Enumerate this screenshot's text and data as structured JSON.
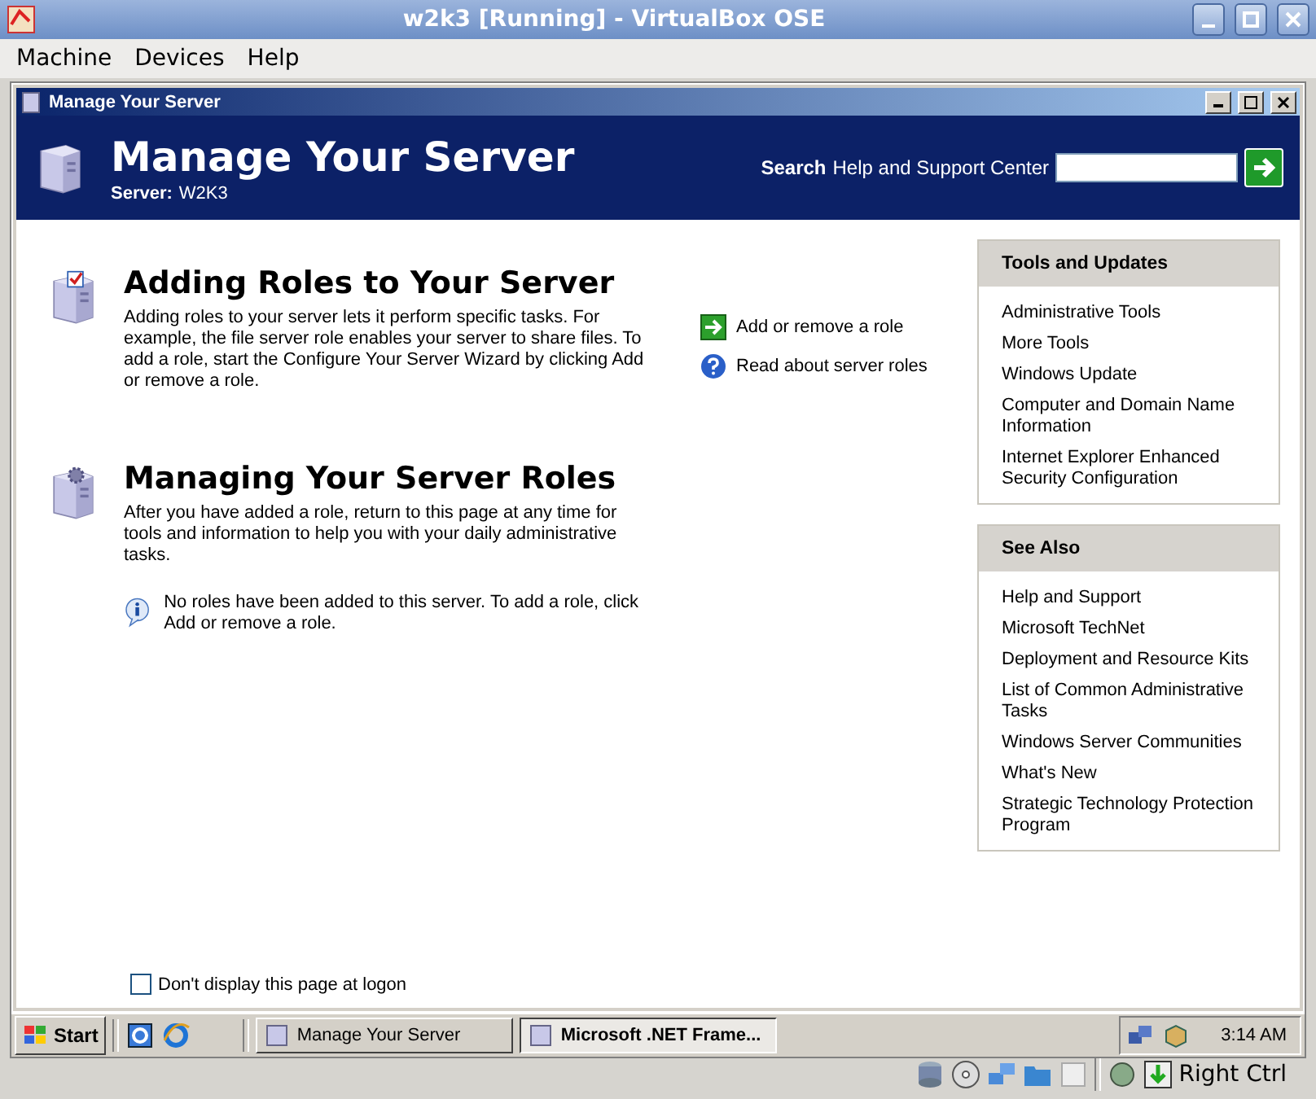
{
  "host_window": {
    "title": "w2k3 [Running] - VirtualBox OSE",
    "menu": [
      "Machine",
      "Devices",
      "Help"
    ]
  },
  "guest_window": {
    "title": "Manage Your Server"
  },
  "banner": {
    "title": "Manage Your Server",
    "server_label": "Server:",
    "server_name": "W2K3",
    "search_label": "Search",
    "search_hint": "Help and Support Center"
  },
  "sections": [
    {
      "kind": "adding",
      "heading": "Adding Roles to Your Server",
      "body": "Adding roles to your server lets it perform specific tasks. For example, the file server role enables your server to share files. To add a role, start the Configure Your Server Wizard by clicking Add or remove a role.",
      "links": [
        {
          "kind": "arrow",
          "label": "Add or remove a role"
        },
        {
          "kind": "help",
          "label": "Read about server roles"
        }
      ]
    },
    {
      "kind": "managing",
      "heading": "Managing Your Server Roles",
      "body": "After you have added a role, return to this page at any time for tools and information to help you with your daily administrative tasks.",
      "note": "No roles have been added to this server. To add a role, click Add or remove a role."
    }
  ],
  "side_panels": [
    {
      "title": "Tools and Updates",
      "links": [
        "Administrative Tools",
        "More Tools",
        "Windows Update",
        "Computer and Domain Name Information",
        "Internet Explorer Enhanced Security Configuration"
      ]
    },
    {
      "title": "See Also",
      "links": [
        "Help and Support",
        "Microsoft TechNet",
        "Deployment and Resource Kits",
        "List of Common Administrative Tasks",
        "Windows Server Communities",
        "What's New",
        "Strategic Technology Protection Program"
      ]
    }
  ],
  "logon_checkbox": {
    "label": "Don't display this page at logon",
    "checked": false
  },
  "taskbar": {
    "start": "Start",
    "buttons": [
      {
        "label": "Manage Your Server",
        "selected": false
      },
      {
        "label": "Microsoft .NET Frame...",
        "selected": true
      }
    ],
    "clock": "3:14 AM"
  },
  "status_bar": {
    "host_key": "Right Ctrl"
  }
}
